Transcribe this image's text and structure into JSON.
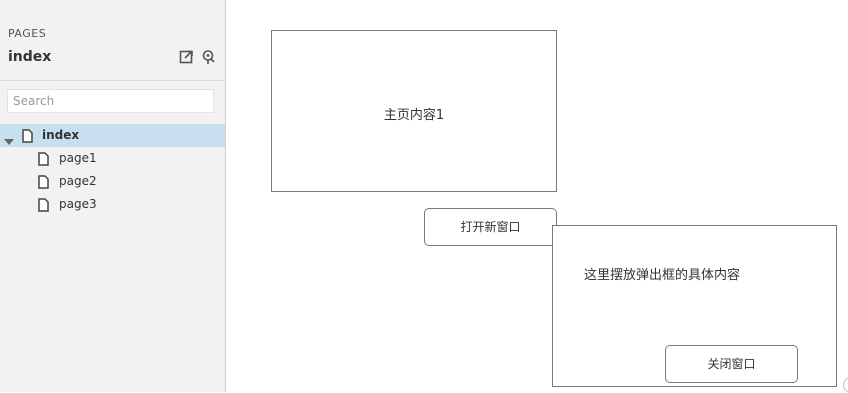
{
  "sidebar": {
    "section_label": "PAGES",
    "project_name": "index",
    "tools": [
      {
        "icon": "export-page-icon"
      },
      {
        "icon": "map-pin-icon"
      }
    ],
    "search": {
      "placeholder": "Search",
      "value": ""
    },
    "tree": [
      {
        "label": "index",
        "level": 0,
        "selected": true,
        "expanded": true
      },
      {
        "label": "page1",
        "level": 1,
        "selected": false
      },
      {
        "label": "page2",
        "level": 1,
        "selected": false
      },
      {
        "label": "page3",
        "level": 1,
        "selected": false
      }
    ]
  },
  "canvas": {
    "main_box_text": "主页内容1",
    "open_button_label": "打开新窗口",
    "popup": {
      "text": "这里摆放弹出框的具体内容",
      "close_button_label": "关闭窗口"
    }
  },
  "colors": {
    "sidebar_bg": "#f2f2f2",
    "selected_bg": "#c8dff0",
    "border": "#797979"
  }
}
